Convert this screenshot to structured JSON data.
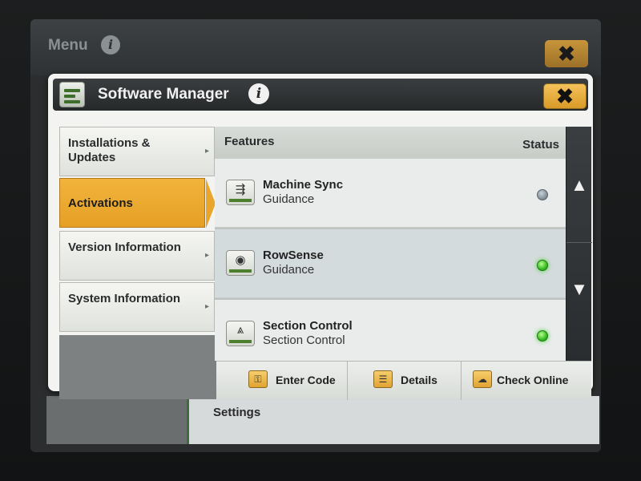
{
  "background_screen": {
    "title": "Menu",
    "info_glyph": "i",
    "close_glyph": "✖",
    "footer_label": "Settings"
  },
  "dialog": {
    "title": "Software Manager",
    "info_glyph": "i",
    "close_glyph": "✖",
    "app_icon": "software-manager-icon"
  },
  "nav": {
    "items": [
      {
        "label": "Installations & Updates",
        "active": false
      },
      {
        "label": "Activations",
        "active": true
      },
      {
        "label": "Version Information",
        "active": false
      },
      {
        "label": "System Information",
        "active": false
      }
    ],
    "arrow_glyph": "▸"
  },
  "features": {
    "header_features": "Features",
    "header_status": "Status",
    "rows": [
      {
        "name": "Machine Sync",
        "category": "Guidance",
        "icon": "machine-sync-icon",
        "status": "inactive",
        "status_color": "#7d8a93"
      },
      {
        "name": "RowSense",
        "category": "Guidance",
        "icon": "rowsense-icon",
        "status": "active",
        "status_color": "#2fb51e"
      },
      {
        "name": "Section Control",
        "category": "Section Control",
        "icon": "section-control-icon",
        "status": "active",
        "status_color": "#2fb51e"
      }
    ],
    "scroll_up_glyph": "▲",
    "scroll_down_glyph": "▼"
  },
  "actions": {
    "enter_code": "Enter Code",
    "details": "Details",
    "check_online": "Check Online"
  },
  "colors": {
    "accent": "#e8a62c",
    "header_dark": "#26292a",
    "status_green": "#2fb51e",
    "status_grey": "#7d8a93"
  }
}
